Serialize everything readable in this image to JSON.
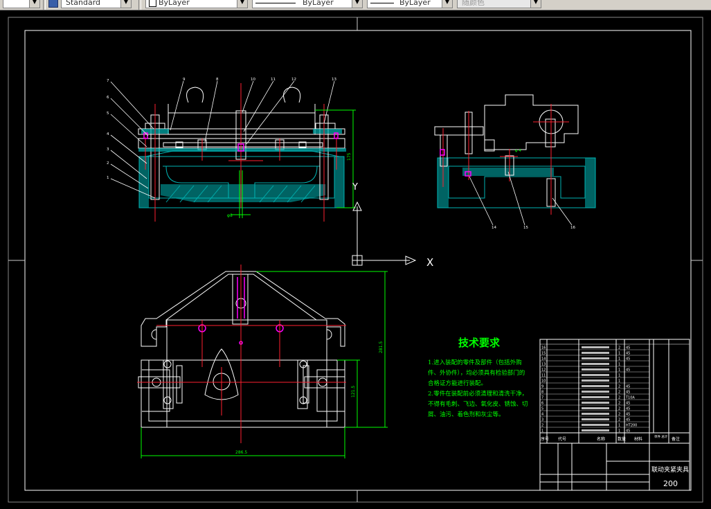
{
  "toolbar": {
    "textstyle": "Standard",
    "color": "ByLayer",
    "linetype": "ByLayer",
    "lineweight": "ByLayer",
    "plotstyle": "随颜色"
  },
  "drawing": {
    "dimensions": {
      "top_height": "175",
      "small_dim": "φ8",
      "plan_height": "281.5",
      "plan_inner": "121.5",
      "plan_width": "286.5",
      "side_dim": "φ 4"
    },
    "balloons_left": [
      "7",
      "6",
      "5",
      "4",
      "3",
      "2",
      "1"
    ],
    "balloons_top": [
      "9",
      "8",
      "10",
      "11",
      "12",
      "13"
    ],
    "balloons_side": [
      "14",
      "15",
      "16"
    ],
    "ucs": {
      "x_label": "X",
      "y_label": "Y"
    }
  },
  "tech_requirements": {
    "title": "技术要求",
    "lines": [
      "1.进入装配的零件及部件（包括外购件、外协件），均必须具有检验部门的合格证方能进行装配。",
      "2.零件在装配前必须清理和清洗干净，不得有毛刺、飞边、氧化皮、锈蚀、切屑、油污、着色剂和灰尘等。"
    ]
  },
  "title_block": {
    "drawing_title": "联动夹紧夹具",
    "scale_number": "200",
    "bom_header": [
      "序号",
      "代号",
      "名称",
      "数量",
      "材料",
      "单件 总计",
      "备注"
    ],
    "bom_rows": [
      {
        "no": "16",
        "qty": "2",
        "mat": "45"
      },
      {
        "no": "15",
        "qty": "1",
        "mat": "45"
      },
      {
        "no": "14",
        "qty": "1",
        "mat": "45"
      },
      {
        "no": "13",
        "qty": "1",
        "mat": ""
      },
      {
        "no": "12",
        "qty": "1",
        "mat": "45"
      },
      {
        "no": "11",
        "qty": "1",
        "mat": ""
      },
      {
        "no": "10",
        "qty": "1",
        "mat": ""
      },
      {
        "no": "9",
        "qty": "2",
        "mat": "45"
      },
      {
        "no": "8",
        "qty": "2",
        "mat": "45"
      },
      {
        "no": "7",
        "qty": "2",
        "mat": "T10A"
      },
      {
        "no": "6",
        "qty": "2",
        "mat": "45"
      },
      {
        "no": "5",
        "qty": "2",
        "mat": "45"
      },
      {
        "no": "4",
        "qty": "2",
        "mat": "45"
      },
      {
        "no": "3",
        "qty": "2",
        "mat": "45"
      },
      {
        "no": "2",
        "qty": "1",
        "mat": "HT200"
      },
      {
        "no": "1",
        "qty": "1",
        "mat": "45"
      }
    ]
  }
}
